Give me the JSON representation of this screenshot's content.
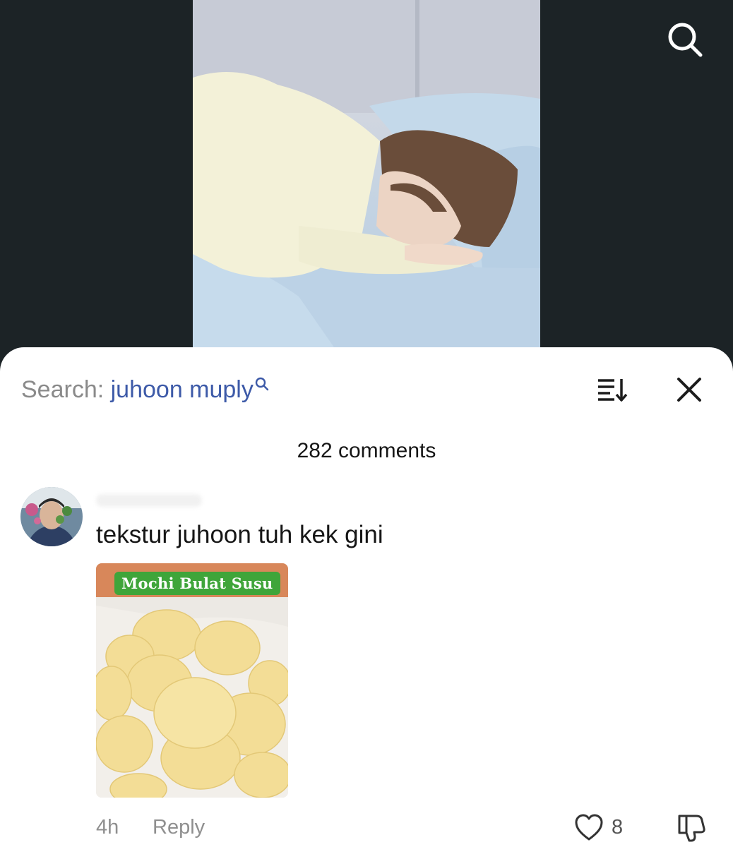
{
  "header": {
    "search_icon": "search-icon"
  },
  "video": {
    "image": "person-sleeping-in-bed-photo"
  },
  "sheet": {
    "search_prefix": "Search: ",
    "search_query": "juhoon muply",
    "sort_icon": "sort-icon",
    "close_icon": "close-icon",
    "comments_count": "282 comments"
  },
  "comment": {
    "avatar": "user-avatar",
    "text": "tekstur juhoon tuh kek gini",
    "media_label": "Mochi Bulat Susu",
    "time": "4h",
    "reply_label": "Reply",
    "like_count": "8",
    "like_icon": "heart-icon",
    "dislike_icon": "thumbs-down-icon"
  },
  "colors": {
    "top_background": "#1c2326",
    "query_link": "#3d5aa8",
    "muted_text": "#8f8f8f",
    "sheet_background": "#ffffff"
  }
}
